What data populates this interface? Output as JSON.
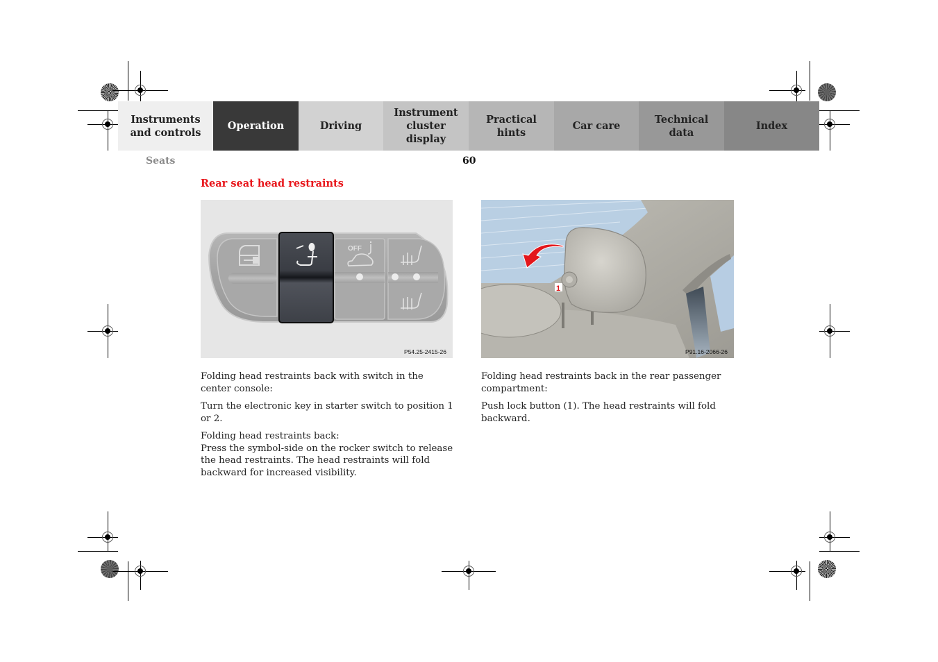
{
  "nav": {
    "tabs": [
      {
        "label_line1": "Instruments",
        "label_line2": "and controls",
        "active": false
      },
      {
        "label_line1": "Operation",
        "label_line2": "",
        "active": true
      },
      {
        "label_line1": "Driving",
        "label_line2": "",
        "active": false
      },
      {
        "label_line1": "Instrument",
        "label_line2": "cluster display",
        "active": false
      },
      {
        "label_line1": "Practical hints",
        "label_line2": "",
        "active": false
      },
      {
        "label_line1": "Car care",
        "label_line2": "",
        "active": false
      },
      {
        "label_line1": "Technical",
        "label_line2": "data",
        "active": false
      },
      {
        "label_line1": "Index",
        "label_line2": "",
        "active": false
      }
    ]
  },
  "header": {
    "section": "Seats",
    "page_number": "60"
  },
  "content": {
    "heading": "Rear seat head restraints",
    "heading_color": "#e8161b",
    "figures": [
      {
        "code": "P54.25-2415-26",
        "description": "Center console switch panel",
        "switch_icons": [
          "door-lock-key-icon",
          "seat-headrest-fold-icon",
          "off-tow-away-alarm-icon",
          "seat-ventilation-icon",
          "seat-heating-icon"
        ]
      },
      {
        "code": "P91.16-2066-26",
        "description": "Rear head restraint with lock button",
        "callout": "1"
      }
    ],
    "left_column": {
      "paragraphs": [
        "Folding head restraints back with switch in the center console:",
        "Turn the electronic key in starter switch to position 1 or 2.",
        "Folding head restraints back:",
        "Press the symbol-side on the rocker switch to release the head restraints. The head restraints will fold backward for increased visibility."
      ]
    },
    "right_column": {
      "paragraphs": [
        "Folding head restraints back in the rear passenger compartment:",
        "Push lock button (1). The head restraints will fold backward."
      ]
    }
  }
}
